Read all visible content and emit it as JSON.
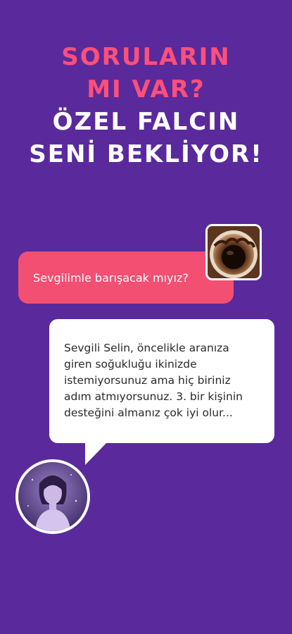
{
  "headline": {
    "line1": "SORULARIN",
    "line2": "MI VAR?",
    "line3": "ÖZEL FALCIN",
    "line4": "SENİ BEKLİYOR!"
  },
  "chat": {
    "user_message": "Sevgilimle barışacak mıyız?",
    "reply_lines": [
      "Sevgili Selin, öncelikle aranıza",
      "giren soğukluğu ikinizde",
      "istemiyorsunuz ama hiç biriniz",
      "adım atmıyorsunuz. 3. bir kişinin",
      "desteğini almanız çok iyi olur..."
    ]
  },
  "colors": {
    "background": "#5a2a9c",
    "accent_pink": "#ff4f7a",
    "bubble_pink": "#f24f72",
    "white": "#ffffff"
  },
  "icons": {
    "coffee_cup": "coffee-cup-image",
    "fortune_teller": "fortune-teller-avatar"
  }
}
